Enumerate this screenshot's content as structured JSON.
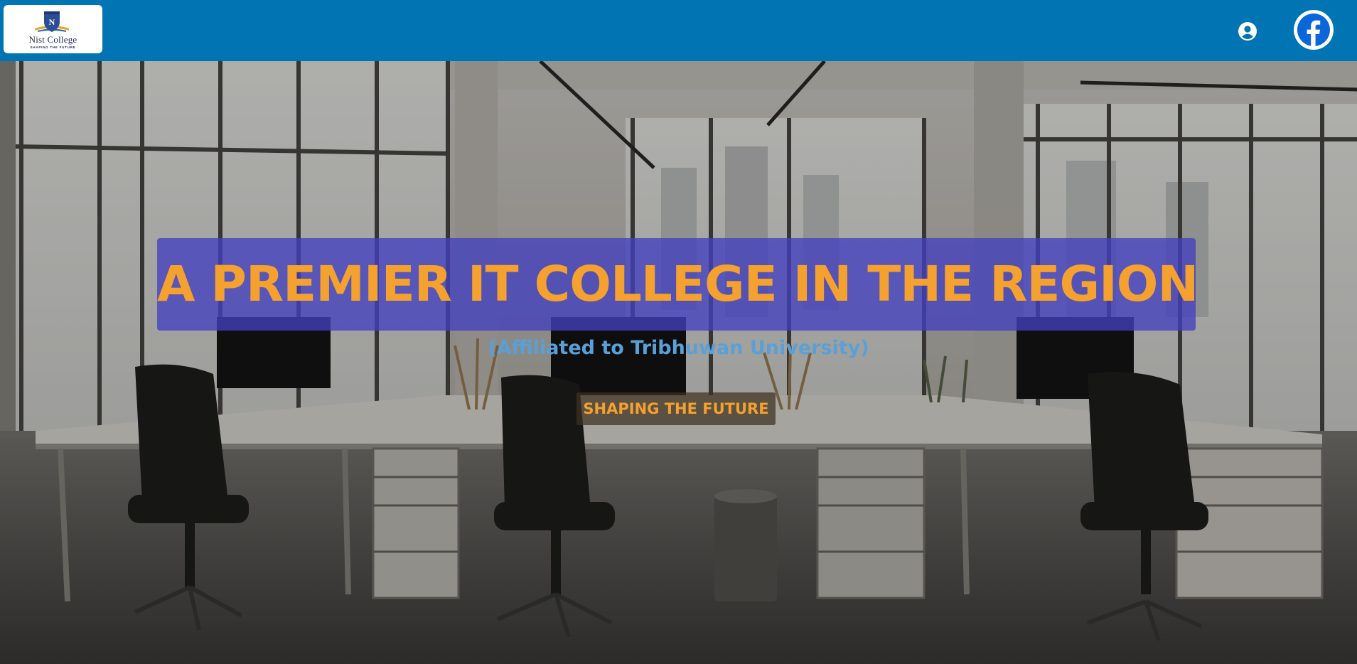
{
  "header": {
    "logo": {
      "name": "Nist College",
      "tagline": "SHAPING THE FUTURE",
      "crest_letters": "N"
    },
    "user_icon": "user-account-icon",
    "facebook_icon": "facebook-icon"
  },
  "hero": {
    "background": "open-plan office photo with desks, chairs and city windows",
    "headline": "A PREMIER IT COLLEGE IN THE REGION",
    "subheadline": "(Affiliated to Tribhuwan University)",
    "tagline_button": "SHAPING THE FUTURE"
  },
  "colors": {
    "header_bg": "#0175b3",
    "headline_text": "#f4a12f",
    "headline_bar": "#4240be",
    "subheadline_text": "#5aa0d8",
    "tagline_text": "#f4a12f"
  }
}
